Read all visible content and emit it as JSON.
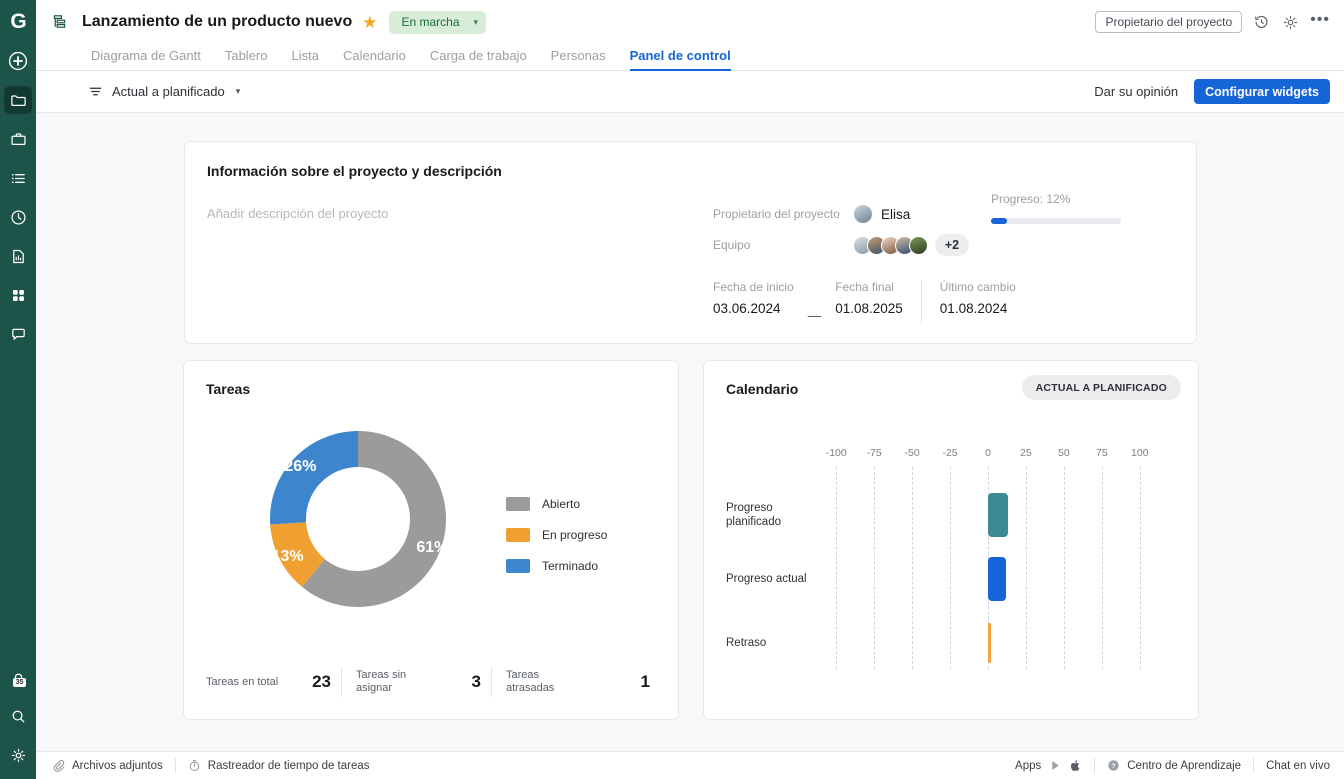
{
  "rail": {
    "logo": "G",
    "items": [
      {
        "name": "add-icon",
        "label": "Añadir"
      },
      {
        "name": "folder-icon",
        "label": "Proyectos"
      },
      {
        "name": "briefcase-icon",
        "label": "Portafolio"
      },
      {
        "name": "list-icon",
        "label": "Lista"
      },
      {
        "name": "clock-icon",
        "label": "Tiempo"
      },
      {
        "name": "report-icon",
        "label": "Informes"
      },
      {
        "name": "grid-icon",
        "label": "Aplicaciones"
      },
      {
        "name": "chat-icon",
        "label": "Mensajes"
      }
    ],
    "notifications_badge": "35",
    "bottom_items": [
      {
        "name": "bell-icon",
        "label": "Notificaciones"
      },
      {
        "name": "search-icon",
        "label": "Buscar"
      },
      {
        "name": "gear-icon",
        "label": "Configuración"
      }
    ]
  },
  "header": {
    "project_icon": "gantt-icon",
    "title": "Lanzamiento de un producto nuevo",
    "starred": true,
    "status": "En marcha",
    "status_bg": "#d8edd9",
    "status_color": "#1c6e33",
    "owner_chip": "Propietario del proyecto",
    "icons": [
      {
        "name": "history-icon"
      },
      {
        "name": "gear-icon"
      }
    ],
    "more": "•••"
  },
  "tabs": [
    {
      "label": "Diagrama de Gantt",
      "active": false
    },
    {
      "label": "Tablero",
      "active": false
    },
    {
      "label": "Lista",
      "active": false
    },
    {
      "label": "Calendario",
      "active": false
    },
    {
      "label": "Carga de trabajo",
      "active": false
    },
    {
      "label": "Personas",
      "active": false
    },
    {
      "label": "Panel de control",
      "active": true
    }
  ],
  "toolbar": {
    "filter_label": "Actual a planificado",
    "feedback_label": "Dar su opinión",
    "configure_label": "Configurar widgets",
    "accent": "#1565d8"
  },
  "info_card": {
    "title": "Información sobre el proyecto y descripción",
    "description_placeholder": "Añadir descripción del proyecto",
    "owner_label": "Propietario del proyecto",
    "owner_name": "Elisa",
    "team_label": "Equipo",
    "team_extra": "+2",
    "team_avatar_count": 5,
    "start_label": "Fecha de inicio",
    "start_value": "03.06.2024",
    "separator": "—",
    "end_label": "Fecha final",
    "end_value": "01.08.2025",
    "last_change_label": "Último cambio",
    "last_change_value": "01.08.2024",
    "progress_label": "Progreso: 12%",
    "progress_percent": 12
  },
  "tasks_card": {
    "title": "Tareas",
    "stats": [
      {
        "label": "Tareas en total",
        "value": "23"
      },
      {
        "label": "Tareas sin asignar",
        "value": "3"
      },
      {
        "label": "Tareas atrasadas",
        "value": "1"
      }
    ]
  },
  "calendar_card": {
    "title": "Calendario",
    "badge": "ACTUAL A PLANIFICADO"
  },
  "footer": {
    "attachments": "Archivos adjuntos",
    "time_tracker": "Rastreador de tiempo de tareas",
    "apps": "Apps",
    "learning": "Centro de Aprendizaje",
    "chat": "Chat en vivo"
  },
  "chart_data": [
    {
      "type": "pie",
      "title": "Tareas",
      "variant": "donut",
      "categories": [
        "Abierto",
        "En progreso",
        "Terminado"
      ],
      "values": [
        61,
        13,
        26
      ],
      "labels": [
        "61%",
        "13%",
        "26%"
      ],
      "colors": [
        "#9b9b9b",
        "#f0a030",
        "#3d85cc"
      ],
      "legend_position": "right",
      "start_angle": 0
    },
    {
      "type": "bar",
      "orientation": "horizontal",
      "title": "Calendario",
      "categories": [
        "Progreso planificado",
        "Progreso actual",
        "Retraso"
      ],
      "values": [
        13,
        12,
        1
      ],
      "colors": [
        "#3e8a93",
        "#1565d8",
        "#f5a33c"
      ],
      "xlabel": "",
      "ylabel": "",
      "xlim": [
        -112,
        112
      ],
      "ticks": [
        -100,
        -75,
        -50,
        -25,
        0,
        25,
        50,
        75,
        100
      ],
      "tick_labels": [
        "-100",
        "-75",
        "-50",
        "-25",
        "0",
        "25",
        "50",
        "75",
        "100"
      ],
      "grid": true
    }
  ]
}
